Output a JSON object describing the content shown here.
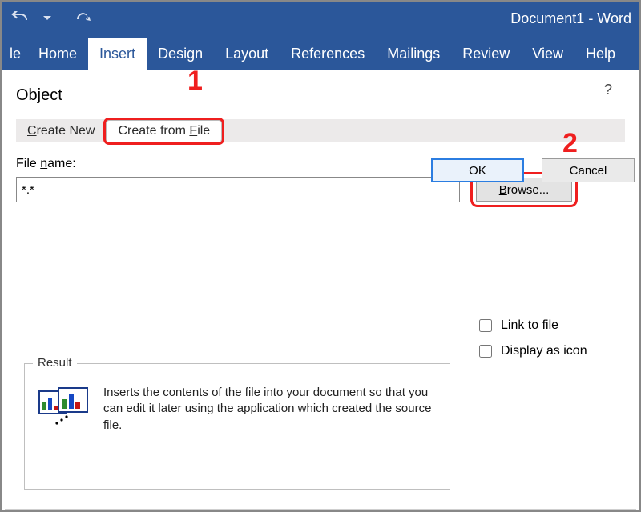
{
  "titlebar": {
    "doc_title": "Document1  -  Word"
  },
  "ribbon": {
    "tabs": {
      "file_partial": "le",
      "home": "Home",
      "insert": "Insert",
      "design": "Design",
      "layout": "Layout",
      "references": "References",
      "mailings": "Mailings",
      "review": "Review",
      "view": "View",
      "help": "Help"
    }
  },
  "dialog": {
    "title": "Object",
    "help_symbol": "?",
    "tab_create_new": "Create New",
    "tab_create_from_file": "Create from File",
    "file_name_label": "File name:",
    "file_name_value": "*.*",
    "browse_label": "Browse...",
    "link_to_file_label": "Link to file",
    "display_as_icon_label": "Display as icon",
    "result_legend": "Result",
    "result_text": "Inserts the contents of the file into your document so that you can edit it later using the application which created the source file.",
    "ok_label": "OK",
    "cancel_label": "Cancel"
  },
  "annotations": {
    "step1": "1",
    "step2": "2"
  }
}
